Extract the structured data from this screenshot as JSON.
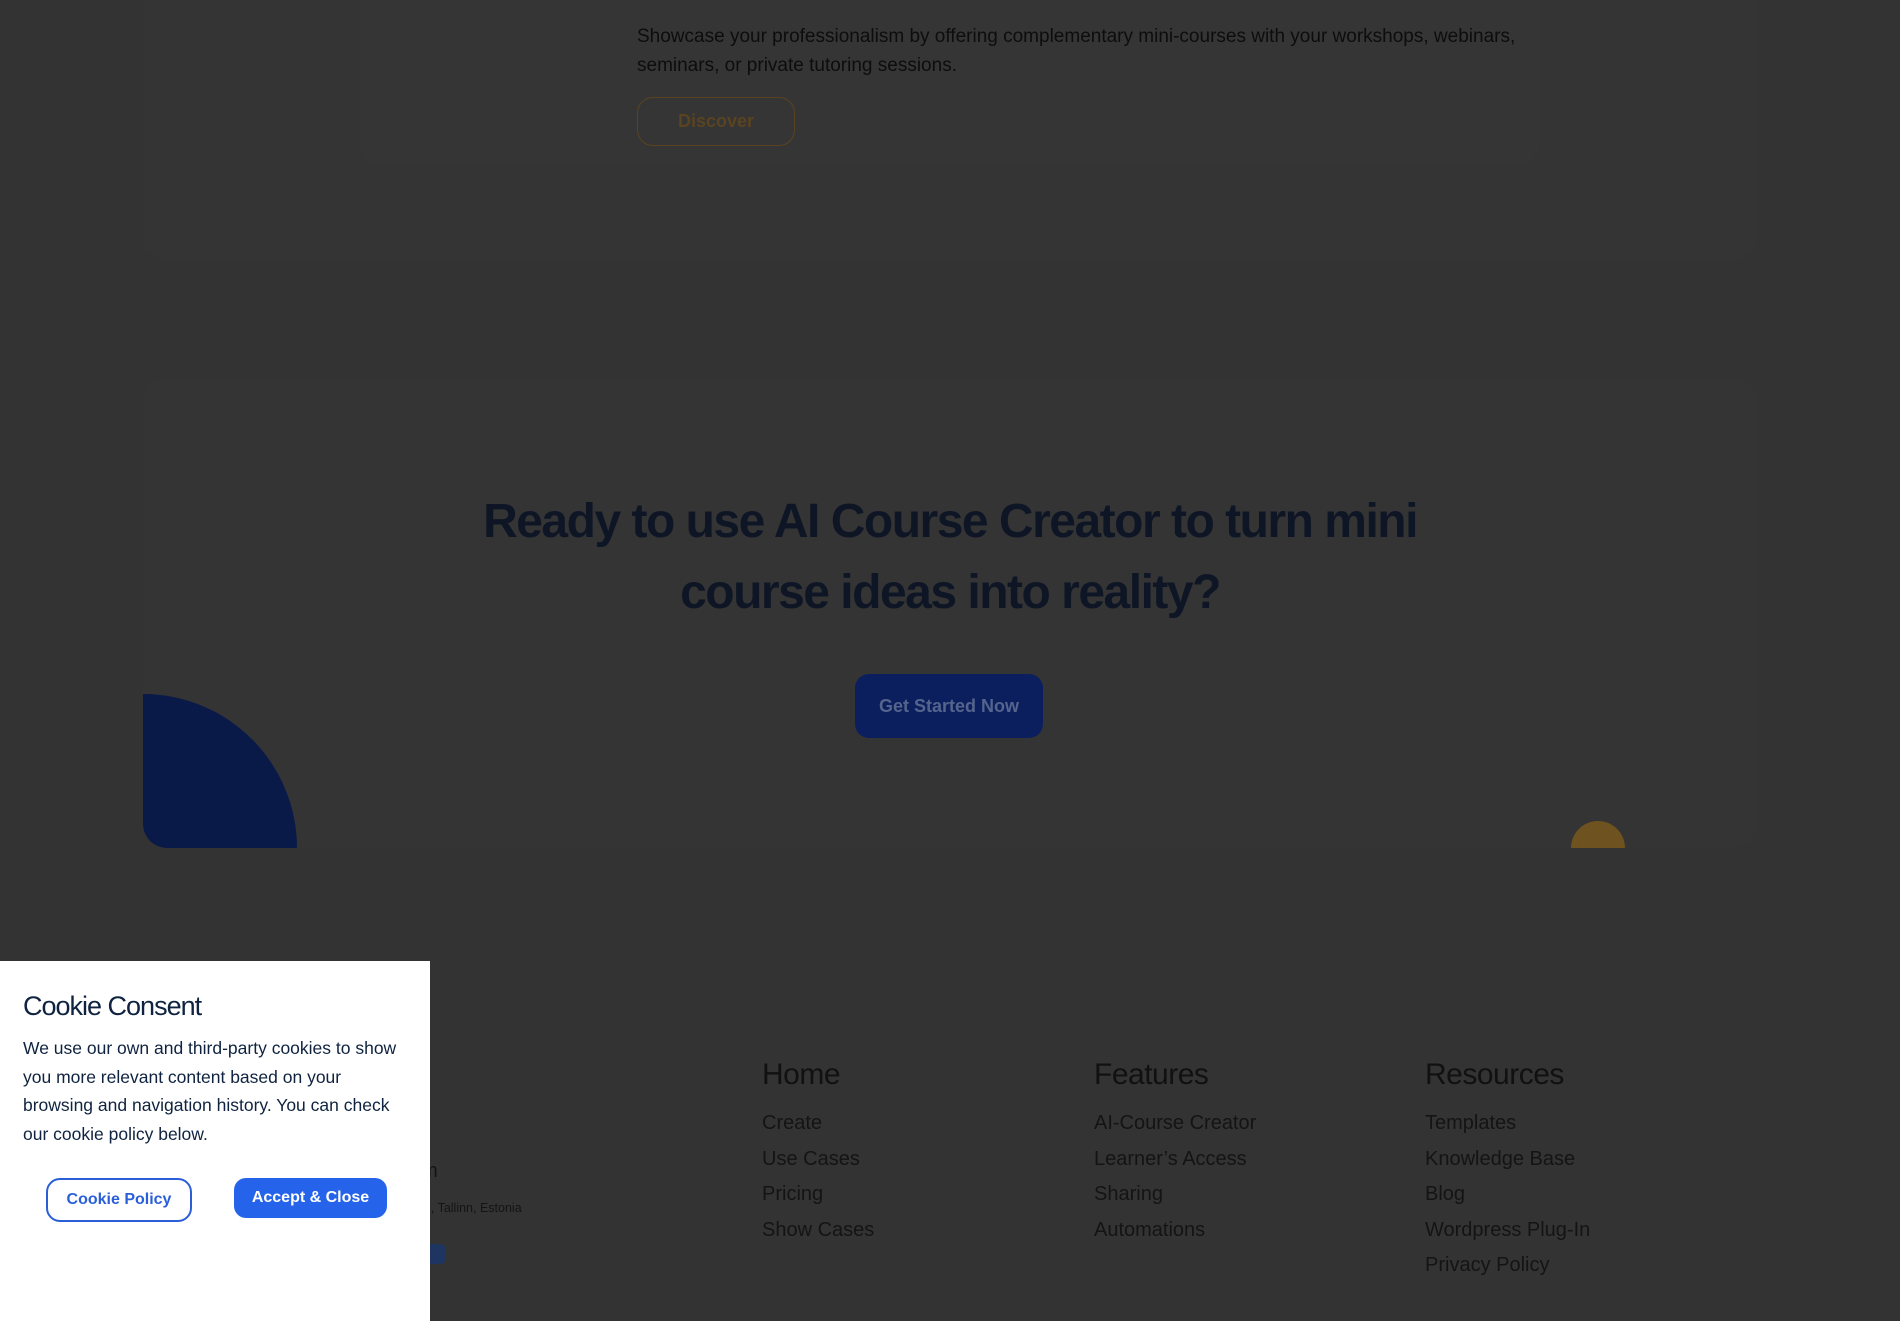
{
  "feature_card": {
    "description": "Showcase your professionalism by offering complementary mini-courses with your workshops, webinars, seminars, or private tutoring sessions.",
    "discover_label": "Discover"
  },
  "cta": {
    "heading_line1": "Ready to use AI Course Creator to turn mini",
    "heading_line2": "course ideas into reality?",
    "button_label": "Get Started Now"
  },
  "footer": {
    "contact_partial": "om",
    "address_partial": "ond, Tallinn, Estonia",
    "columns": [
      {
        "title": "Home",
        "links": [
          "Create",
          "Use Cases",
          "Pricing",
          "Show Cases"
        ]
      },
      {
        "title": "Features",
        "links": [
          "AI-Course Creator",
          "Learner’s Access",
          "Sharing",
          "Automations"
        ]
      },
      {
        "title": "Resources",
        "links": [
          "Templates",
          "Knowledge Base",
          "Blog",
          "Wordpress Plug-In",
          "Privacy Policy"
        ]
      }
    ]
  },
  "cookie_consent": {
    "title": "Cookie Consent",
    "message": "We use our own and third-party cookies to show you more relevant content based on your browsing and navigation history. You can check our cookie policy below.",
    "policy_label": "Cookie Policy",
    "accept_label": "Accept & Close",
    "accent_color": "#2563eb"
  }
}
